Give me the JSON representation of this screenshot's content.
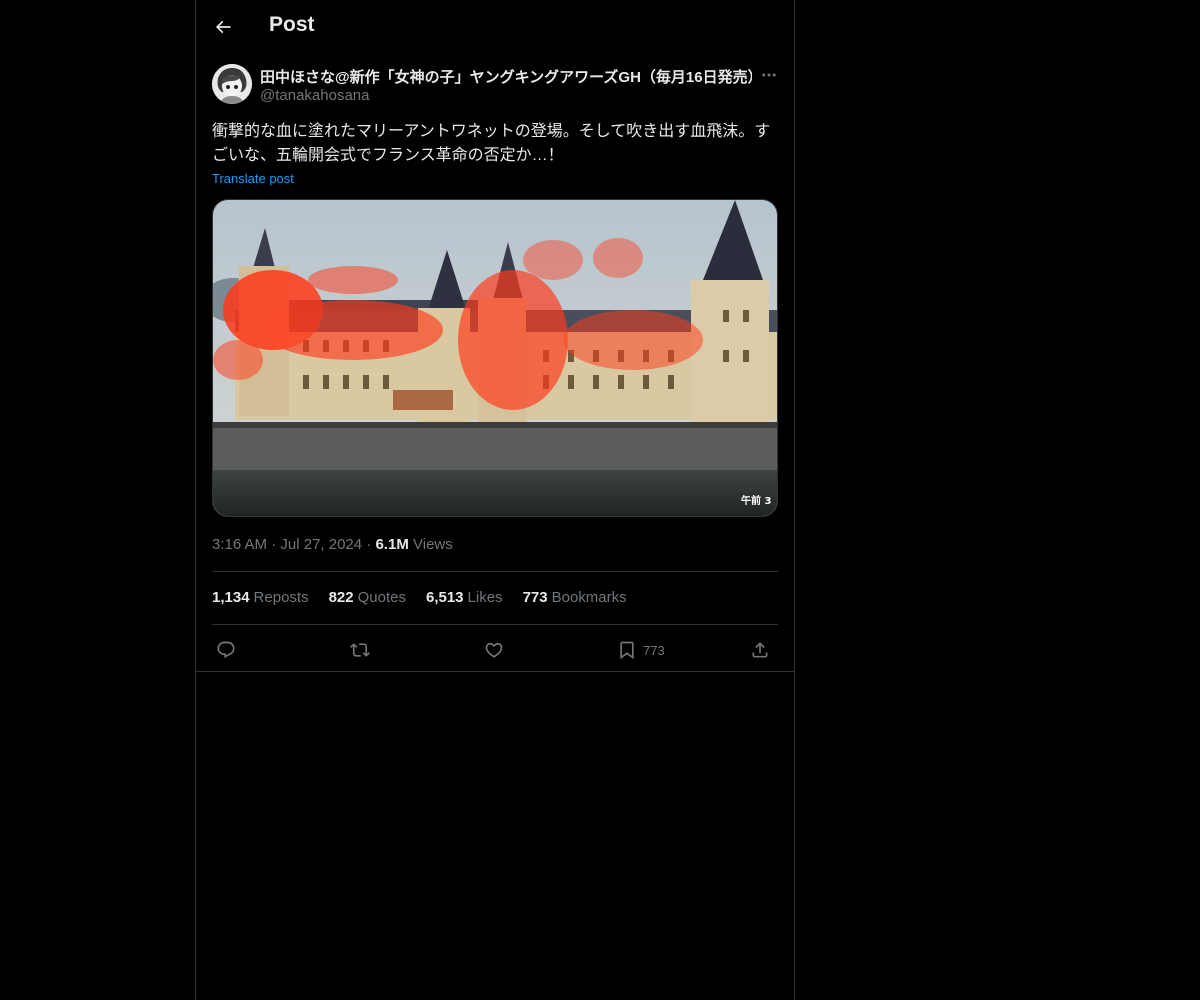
{
  "header": {
    "title": "Post",
    "back_icon": "arrow-left-icon"
  },
  "author": {
    "display_name": "田中ほさな@新作「女神の子」ヤングキングアワーズGH（毎月16日発売）",
    "handle": "@tanakahosana",
    "more_icon": "more-horizontal-icon"
  },
  "post": {
    "text": "衝撃的な血に塗れたマリーアントワネットの登場。そして吹き出す血飛沫。すごいな、五輪開会式でフランス革命の否定か…！",
    "translate_label": "Translate post",
    "media_overlay_text": "午前 3",
    "time": "3:16 AM",
    "date": "Jul 27, 2024",
    "separator": "·",
    "views_count": "6.1M",
    "views_label": "Views"
  },
  "stats": {
    "reposts": {
      "count": "1,134",
      "label": "Reposts"
    },
    "quotes": {
      "count": "822",
      "label": "Quotes"
    },
    "likes": {
      "count": "6,513",
      "label": "Likes"
    },
    "bookmarks": {
      "count": "773",
      "label": "Bookmarks"
    }
  },
  "actions": {
    "reply_icon": "reply-icon",
    "repost_icon": "repost-icon",
    "like_icon": "heart-icon",
    "bookmark_icon": "bookmark-icon",
    "bookmark_count": "773",
    "share_icon": "share-icon"
  },
  "colors": {
    "background": "#000000",
    "text_primary": "#e7e9ea",
    "text_secondary": "#71767b",
    "link": "#1d9bf0",
    "border": "#2f3336"
  }
}
